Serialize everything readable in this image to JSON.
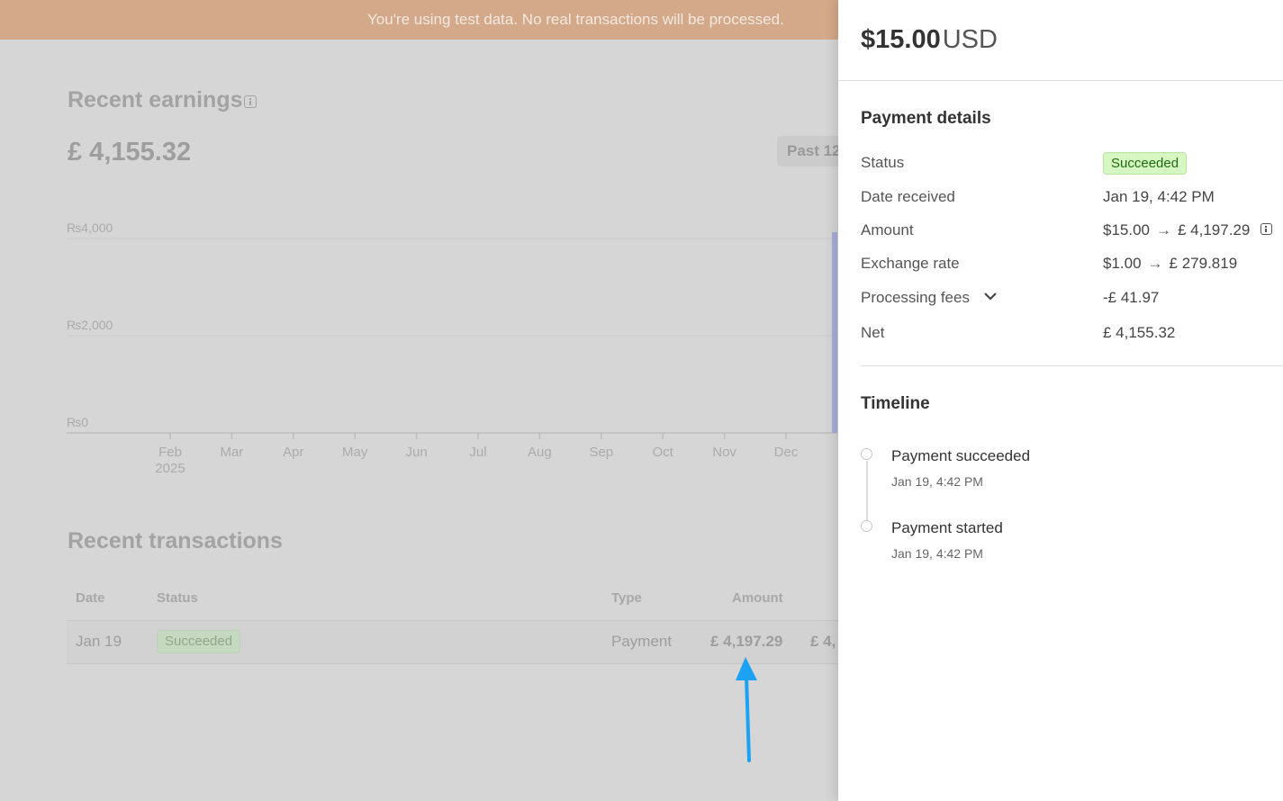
{
  "banner": {
    "text": "You're using test data. No real transactions will be processed."
  },
  "earnings": {
    "title": "Recent earnings",
    "total": "£ 4,155.32",
    "range_label": "Past 12"
  },
  "chart_data": {
    "type": "bar",
    "y_ticks": [
      "₨4,000",
      "₨2,000",
      "₨0"
    ],
    "x_ticks": [
      "Feb",
      "Mar",
      "Apr",
      "May",
      "Jun",
      "Jul",
      "Aug",
      "Sep",
      "Oct",
      "Nov",
      "Dec"
    ],
    "x_year": "2025",
    "bar_color": "#a9aedb",
    "ylim": [
      0,
      4000
    ]
  },
  "transactions": {
    "title": "Recent transactions",
    "columns": [
      "Date",
      "Status",
      "Type",
      "Amount"
    ],
    "rows": [
      {
        "date": "Jan 19",
        "status": "Succeeded",
        "type": "Payment",
        "amount": "£ 4,197.29",
        "net": "£ 4,"
      }
    ]
  },
  "panel": {
    "amount": "$15.00",
    "currency": "USD",
    "details_title": "Payment details",
    "details": {
      "status_label": "Status",
      "status_value": "Succeeded",
      "date_label": "Date received",
      "date_value": "Jan 19, 4:42 PM",
      "amount_label": "Amount",
      "amount_from": "$15.00",
      "amount_to": "£ 4,197.29",
      "rate_label": "Exchange rate",
      "rate_from": "$1.00",
      "rate_to": "£ 279.819",
      "fees_label": "Processing fees",
      "fees_value": "-£ 41.97",
      "net_label": "Net",
      "net_value": "£ 4,155.32"
    },
    "timeline_title": "Timeline",
    "timeline": [
      {
        "title": "Payment succeeded",
        "time": "Jan 19, 4:42 PM"
      },
      {
        "title": "Payment started",
        "time": "Jan 19, 4:42 PM"
      }
    ]
  },
  "colors": {
    "banner": "#d4a98a",
    "success_bg": "#d7f7c2",
    "success_text": "#1f6b12",
    "annotation_arrow": "#1da1f2"
  }
}
